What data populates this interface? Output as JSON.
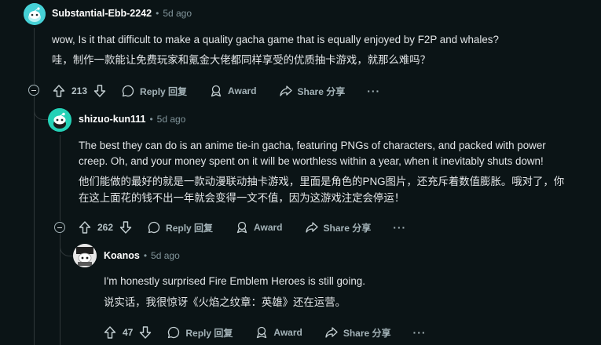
{
  "comments": [
    {
      "author": "Substantial-Ebb-2242",
      "separator": "•",
      "time": "5d ago",
      "text_en": "wow, Is it that difficult to make a quality gacha game that is equally enjoyed by F2P and whales?",
      "text_zh": "哇，制作一款能让免费玩家和氪金大佬都同样享受的优质抽卡游戏，就那么难吗？",
      "score": "213",
      "reply_label": "Reply 回复",
      "award_label": "Award",
      "share_label": "Share 分享",
      "more_label": "···",
      "avatar_color": "#46d1d6"
    },
    {
      "author": "shizuo-kun111",
      "separator": "•",
      "time": "5d ago",
      "text_en_1": "The best they can do is an anime tie-in gacha, featuring PNGs of characters, and packed with power",
      "text_en_2": "creep. Oh, and your money spent on it will be worthless within a year, when it inevitably shuts down!",
      "text_zh_1": "他们能做的最好的就是一款动漫联动抽卡游戏，里面是角色的PNG图片，还充斥着数值膨胀。哦对了，你",
      "text_zh_2": "在这上面花的钱不出一年就会变得一文不值，因为这游戏注定会停运！",
      "score": "262",
      "reply_label": "Reply 回复",
      "award_label": "Award",
      "share_label": "Share 分享",
      "more_label": "···",
      "avatar_color": "#24d1b6"
    },
    {
      "author": "Koanos",
      "separator": "•",
      "time": "5d ago",
      "text_en": "I'm honestly surprised Fire Emblem Heroes is still going.",
      "text_zh": "说实话，我很惊讶《火焰之纹章：英雄》还在运营。",
      "score": "47",
      "reply_label": "Reply 回复",
      "award_label": "Award",
      "share_label": "Share 分享",
      "more_label": "···"
    }
  ],
  "colors": {
    "background": "#0b1416",
    "thread_line": "#2f3739",
    "meta_text": "#82959b",
    "action_text": "#a4b3b8"
  }
}
